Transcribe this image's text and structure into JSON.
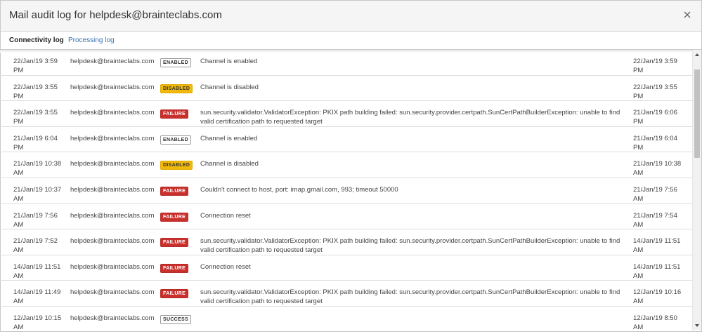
{
  "dialog": {
    "title": "Mail audit log for helpdesk@brainteclabs.com",
    "close_icon": "close-icon"
  },
  "tabs": [
    {
      "label": "Connectivity log",
      "active": true
    },
    {
      "label": "Processing log",
      "active": false
    }
  ],
  "rows": [
    {
      "time": "22/Jan/19 3:59 PM",
      "email": "helpdesk@brainteclabs.com",
      "status": "ENABLED",
      "status_type": "enabled",
      "message": "Channel is enabled",
      "time2": "22/Jan/19 3:59 PM"
    },
    {
      "time": "22/Jan/19 3:55 PM",
      "email": "helpdesk@brainteclabs.com",
      "status": "DISABLED",
      "status_type": "disabled",
      "message": "Channel is disabled",
      "time2": "22/Jan/19 3:55 PM"
    },
    {
      "time": "22/Jan/19 3:55 PM",
      "email": "helpdesk@brainteclabs.com",
      "status": "FAILURE",
      "status_type": "failure",
      "message": "sun.security.validator.ValidatorException: PKIX path building failed: sun.security.provider.certpath.SunCertPathBuilderException: unable to find valid certification path to requested target",
      "time2": "21/Jan/19 6:06 PM"
    },
    {
      "time": "21/Jan/19 6:04 PM",
      "email": "helpdesk@brainteclabs.com",
      "status": "ENABLED",
      "status_type": "enabled",
      "message": "Channel is enabled",
      "time2": "21/Jan/19 6:04 PM"
    },
    {
      "time": "21/Jan/19 10:38 AM",
      "email": "helpdesk@brainteclabs.com",
      "status": "DISABLED",
      "status_type": "disabled",
      "message": "Channel is disabled",
      "time2": "21/Jan/19 10:38 AM"
    },
    {
      "time": "21/Jan/19 10:37 AM",
      "email": "helpdesk@brainteclabs.com",
      "status": "FAILURE",
      "status_type": "failure",
      "message": "Couldn't connect to host, port: imap.gmail.com, 993; timeout 50000",
      "time2": "21/Jan/19 7:56 AM"
    },
    {
      "time": "21/Jan/19 7:56 AM",
      "email": "helpdesk@brainteclabs.com",
      "status": "FAILURE",
      "status_type": "failure",
      "message": "Connection reset",
      "time2": "21/Jan/19 7:54 AM"
    },
    {
      "time": "21/Jan/19 7:52 AM",
      "email": "helpdesk@brainteclabs.com",
      "status": "FAILURE",
      "status_type": "failure",
      "message": "sun.security.validator.ValidatorException: PKIX path building failed: sun.security.provider.certpath.SunCertPathBuilderException: unable to find valid certification path to requested target",
      "time2": "14/Jan/19 11:51 AM"
    },
    {
      "time": "14/Jan/19 11:51 AM",
      "email": "helpdesk@brainteclabs.com",
      "status": "FAILURE",
      "status_type": "failure",
      "message": "Connection reset",
      "time2": "14/Jan/19 11:51 AM"
    },
    {
      "time": "14/Jan/19 11:49 AM",
      "email": "helpdesk@brainteclabs.com",
      "status": "FAILURE",
      "status_type": "failure",
      "message": "sun.security.validator.ValidatorException: PKIX path building failed: sun.security.provider.certpath.SunCertPathBuilderException: unable to find valid certification path to requested target",
      "time2": "12/Jan/19 10:16 AM"
    },
    {
      "time": "12/Jan/19 10:15 AM",
      "email": "helpdesk@brainteclabs.com",
      "status": "SUCCESS",
      "status_type": "success",
      "message": "",
      "time2": "12/Jan/19 8:50 AM"
    }
  ],
  "colors": {
    "failure": "#c9302c",
    "disabled": "#f0b90b",
    "link": "#3572b0"
  }
}
